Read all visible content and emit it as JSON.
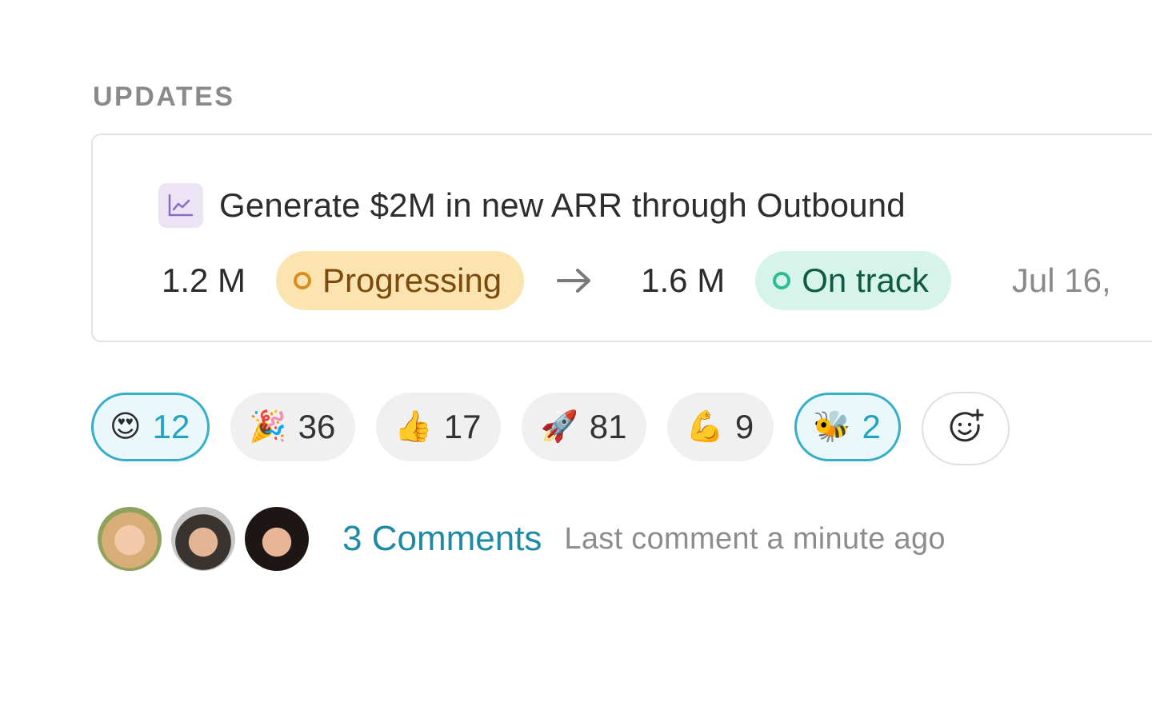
{
  "section": {
    "heading": "UPDATES"
  },
  "update": {
    "goal_icon": "line-chart-icon",
    "goal_title": "Generate $2M in new ARR through Outbound",
    "from_value": "1.2 M",
    "from_status": "Progressing",
    "arrow_icon": "arrow-right-icon",
    "to_value": "1.6 M",
    "to_status": "On track",
    "date": "Jul 16,",
    "colors": {
      "progressing_bg": "#fbe4b0",
      "progressing_text": "#7d4a0e",
      "ontrack_bg": "#d6f4ea",
      "ontrack_text": "#0f5a44"
    }
  },
  "reactions": [
    {
      "emoji": "😍",
      "icon": "heart-eyes-emoji",
      "count": "12",
      "active": true
    },
    {
      "emoji": "🎉",
      "icon": "party-popper-emoji",
      "count": "36",
      "active": false
    },
    {
      "emoji": "👍",
      "icon": "thumbs-up-emoji",
      "count": "17",
      "active": false
    },
    {
      "emoji": "🚀",
      "icon": "rocket-emoji",
      "count": "81",
      "active": false
    },
    {
      "emoji": "💪",
      "icon": "flexed-biceps-emoji",
      "count": "9",
      "active": false
    },
    {
      "emoji": "🐝",
      "icon": "honeybee-emoji",
      "count": "2",
      "active": true
    }
  ],
  "add_reaction": {
    "icon": "add-reaction-icon"
  },
  "comments": {
    "avatars": [
      "commenter-1",
      "commenter-2",
      "commenter-3"
    ],
    "link_text": "3 Comments",
    "meta_text": "Last comment a minute ago"
  },
  "accent_color": "#23a3c0"
}
